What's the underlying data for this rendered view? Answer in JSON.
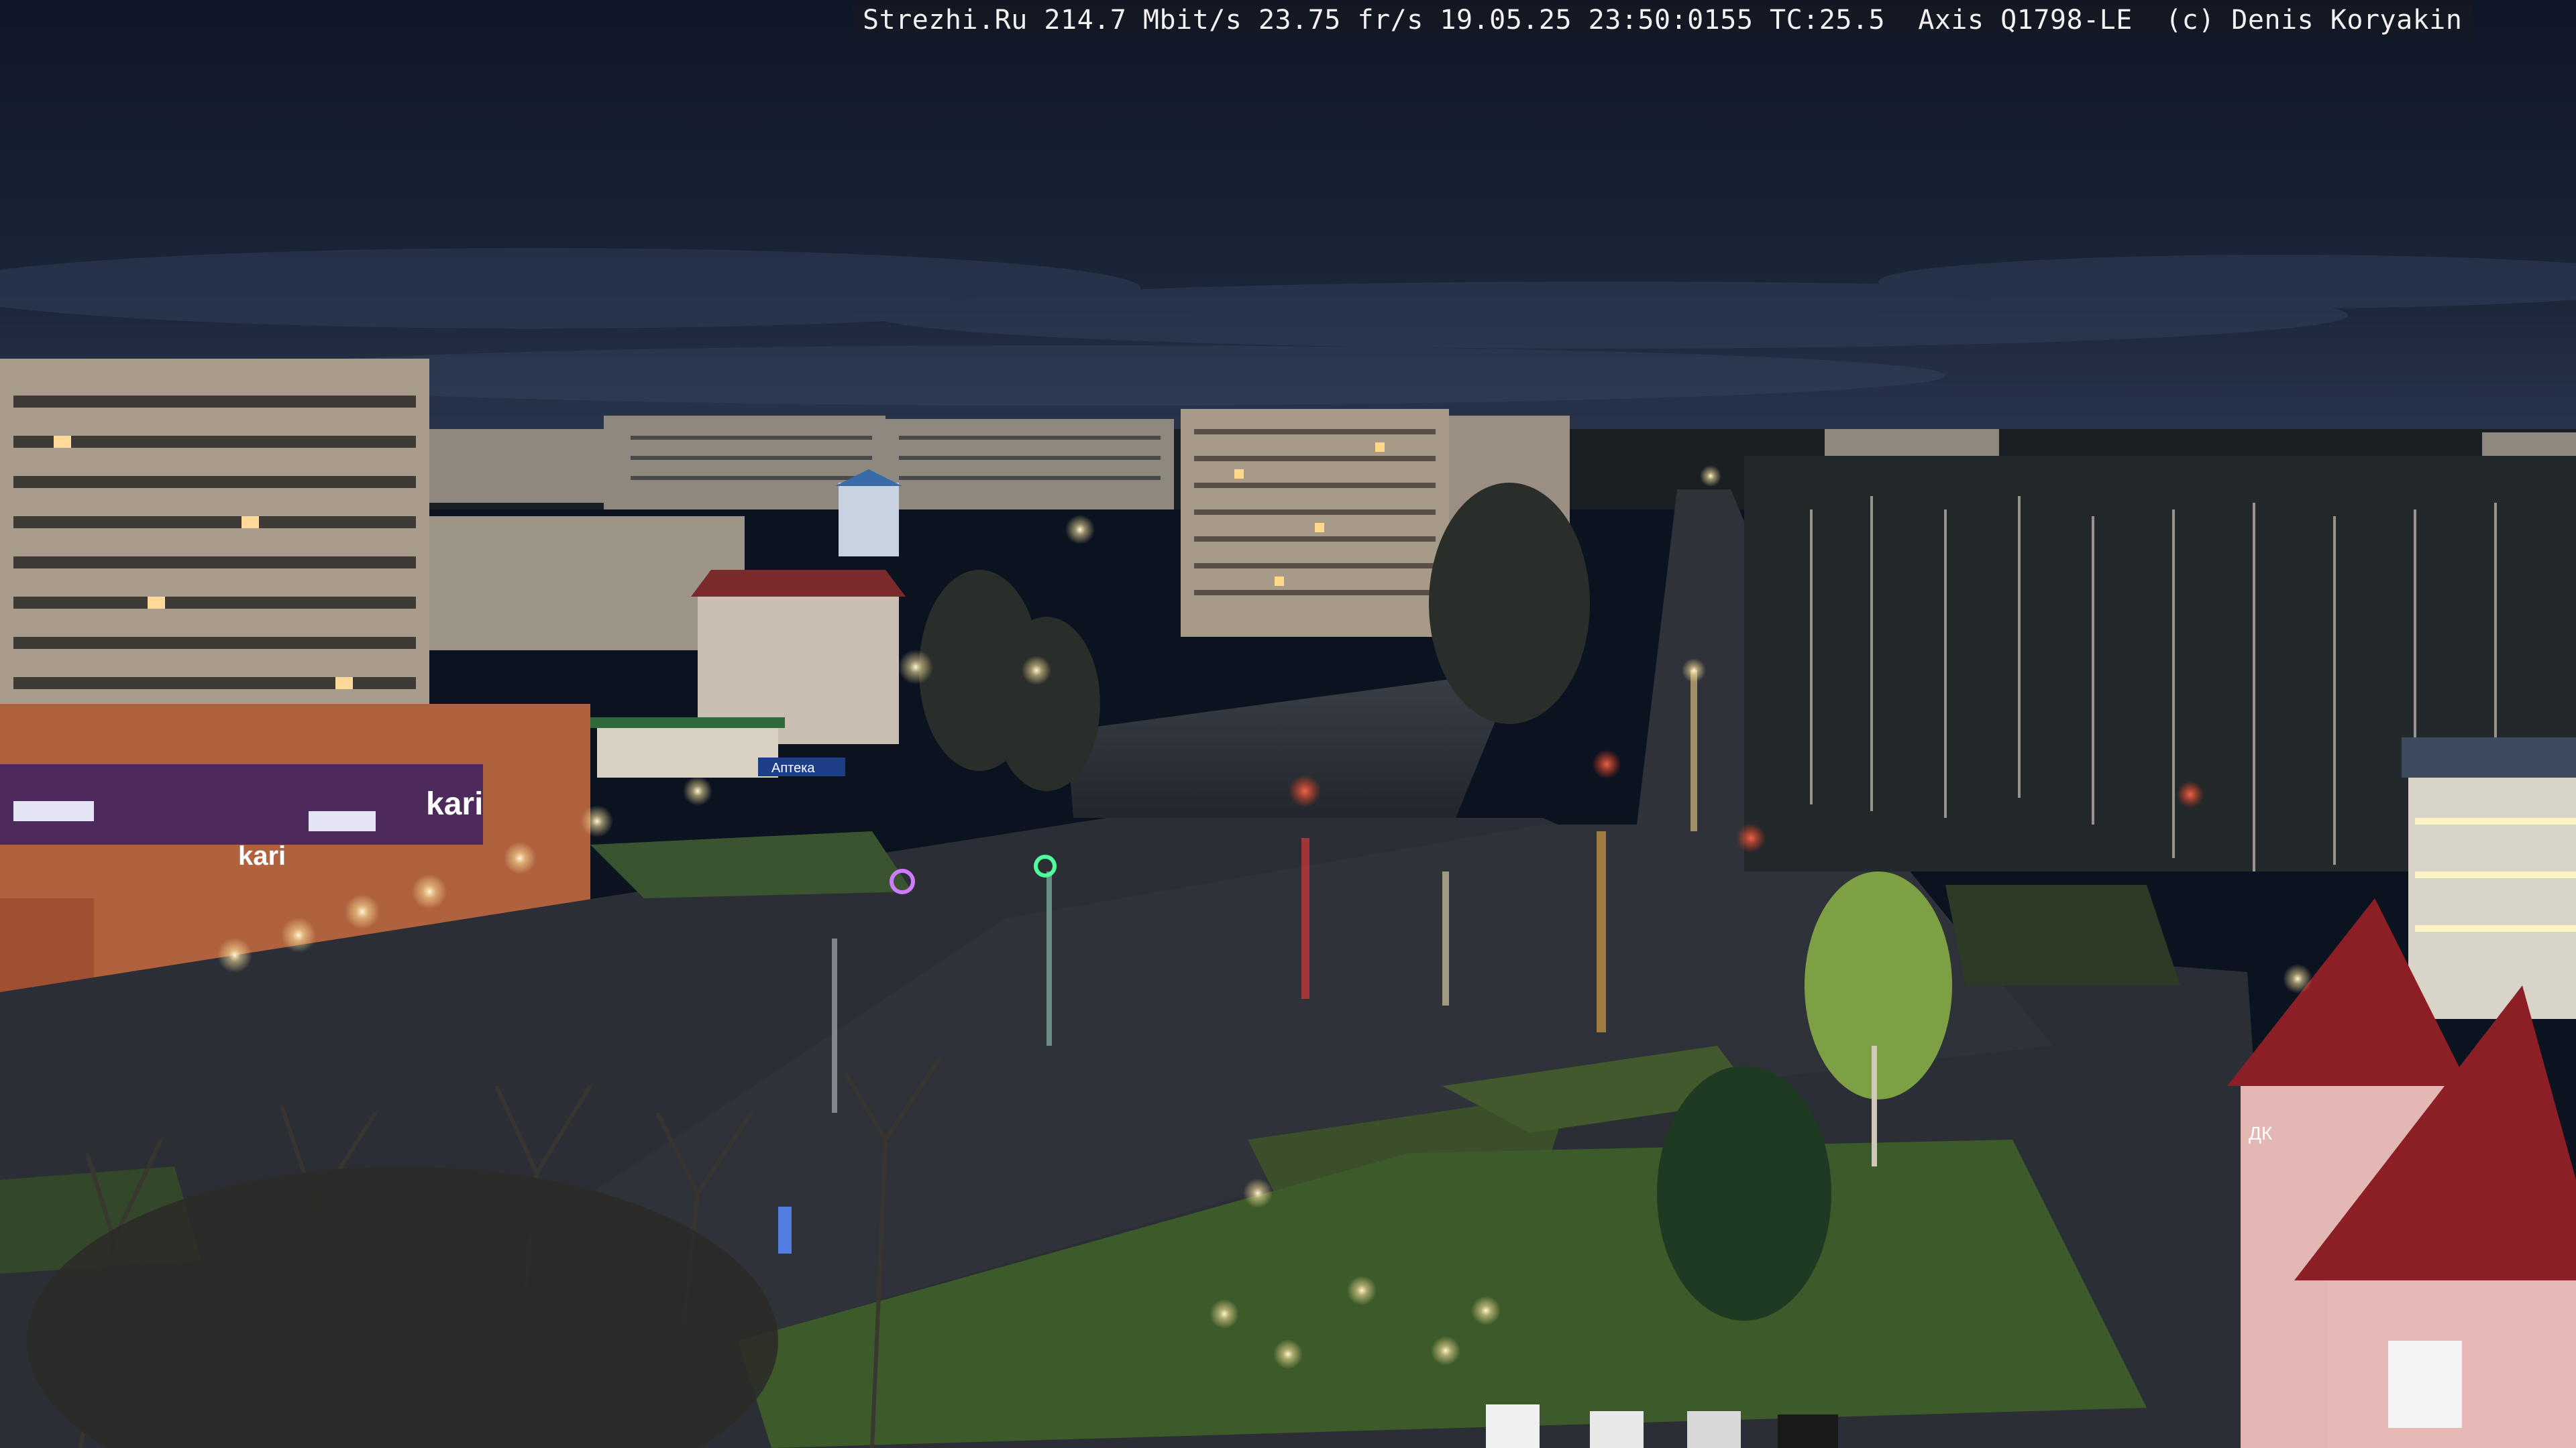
{
  "camera_overlay": {
    "text": "Strezhi.Ru 214.7 Mbit/s 23.75 fr/s 19.05.25 23:50:0155 TC:25.5  Axis Q1798-LE  (c) Denis Koryakin"
  },
  "signage": {
    "store_sign_large": "kari",
    "store_sign_small": "kari",
    "pharmacy_sign": "Аптека",
    "building_sign_right": "ДК"
  },
  "colors": {
    "sky_top": "#121a2c",
    "sky_horizon": "#26324a",
    "ground": "#2a2e34",
    "grass": "#3d5a2a",
    "street_light": "#fff3c8",
    "sign_purple": "#5b2a7a",
    "roof_red": "#8c1f26"
  }
}
